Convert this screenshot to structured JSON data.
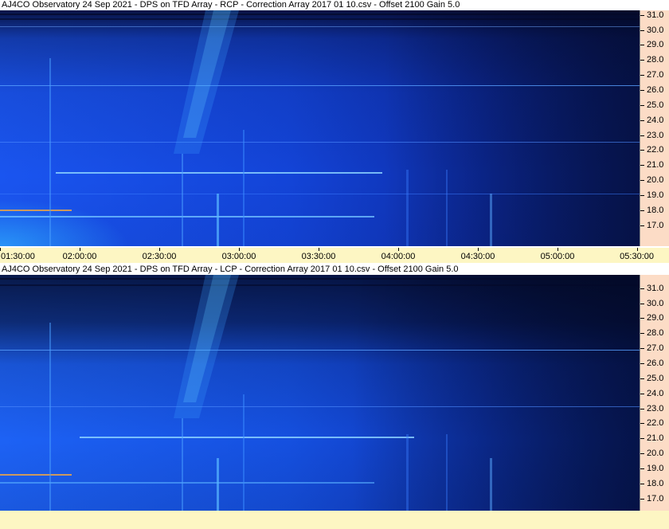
{
  "panels": [
    {
      "title": "AJ4CO Observatory 24 Sep 2021  -  DPS on TFD Array  -  RCP  -  Correction Array 2017 01 10.csv  -  Offset 2100  Gain 5.0",
      "polarization": "RCP"
    },
    {
      "title": "AJ4CO Observatory 24 Sep 2021  -  DPS on TFD Array  -  LCP  -  Correction Array 2017 01 10.csv  -  Offset 2100  Gain 5.0",
      "polarization": "LCP"
    }
  ],
  "frequency_labels": [
    "31.0",
    "30.0",
    "29.0",
    "28.0",
    "27.0",
    "26.0",
    "25.0",
    "24.0",
    "23.0",
    "22.0",
    "21.0",
    "20.0",
    "19.0",
    "18.0",
    "17.0"
  ],
  "time_labels": [
    "01:30:00",
    "02:00:00",
    "02:30:00",
    "03:00:00",
    "03:30:00",
    "04:00:00",
    "04:30:00",
    "05:00:00",
    "05:30:00"
  ],
  "colors": {
    "spectrogram_dark": "#07103a",
    "spectrogram_mid": "#1240d8",
    "spectrogram_bright": "#2a8cff",
    "freq_axis_bg": "#fcdcc6",
    "time_axis_bg": "#fdf6c3"
  }
}
